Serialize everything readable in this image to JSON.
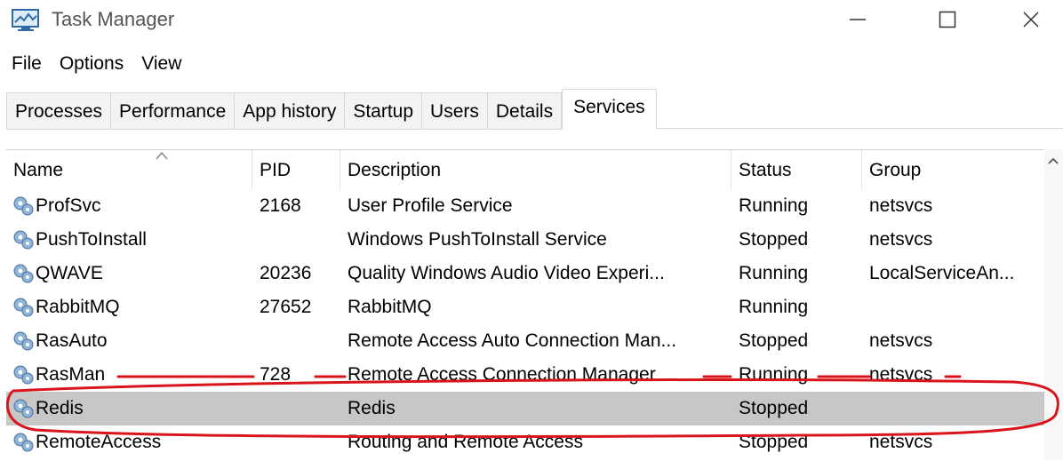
{
  "window": {
    "title": "Task Manager",
    "icon": "task-manager-icon",
    "controls": [
      "minimize-icon",
      "maximize-icon",
      "close-icon"
    ]
  },
  "menu": [
    "File",
    "Options",
    "View"
  ],
  "tabs": [
    "Processes",
    "Performance",
    "App history",
    "Startup",
    "Users",
    "Details",
    "Services"
  ],
  "active_tab": "Services",
  "table": {
    "columns": [
      "Name",
      "PID",
      "Description",
      "Status",
      "Group"
    ],
    "sorted_column": "Name",
    "rows": [
      {
        "name": "ProfSvc",
        "pid": "2168",
        "description": "User Profile Service",
        "status": "Running",
        "group": "netsvcs"
      },
      {
        "name": "PushToInstall",
        "pid": "",
        "description": "Windows PushToInstall Service",
        "status": "Stopped",
        "group": "netsvcs"
      },
      {
        "name": "QWAVE",
        "pid": "20236",
        "description": "Quality Windows Audio Video Experi...",
        "status": "Running",
        "group": "LocalServiceAn..."
      },
      {
        "name": "RabbitMQ",
        "pid": "27652",
        "description": "RabbitMQ",
        "status": "Running",
        "group": ""
      },
      {
        "name": "RasAuto",
        "pid": "",
        "description": "Remote Access Auto Connection Man...",
        "status": "Stopped",
        "group": "netsvcs"
      },
      {
        "name": "RasMan",
        "pid": "728",
        "description": "Remote Access Connection Manager",
        "status": "Running",
        "group": "netsvcs"
      },
      {
        "name": "Redis",
        "pid": "",
        "description": "Redis",
        "status": "Stopped",
        "group": ""
      },
      {
        "name": "RemoteAccess",
        "pid": "",
        "description": "Routing and Remote Access",
        "status": "Stopped",
        "group": "netsvcs"
      }
    ],
    "selected_row": 6
  },
  "annotation": {
    "color": "#d9141b"
  }
}
